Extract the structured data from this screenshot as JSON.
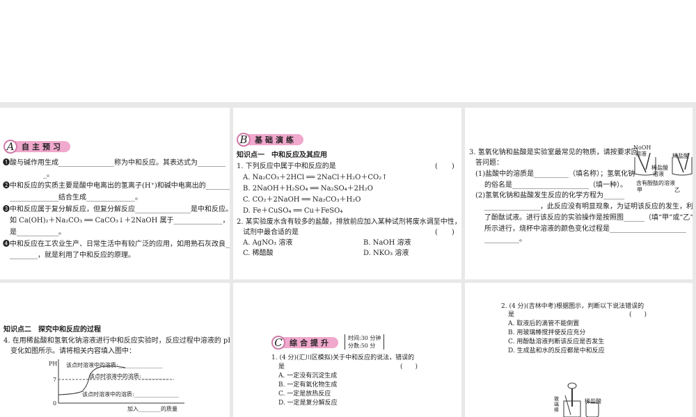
{
  "sectionA": {
    "letter": "A",
    "title": "自主预习",
    "lines": [
      "❶酸与碱作用生成________________称为中和反应。其表达式为________",
      "_。",
      "❷中和反应的实质主要是酸中电离出的氢离子(H⁺)和碱中电离出的________",
      "______________结合生成______________。",
      "❸中和反应属于复分解反应，但复分解反应________________是中和反应。",
      "如 Ca(OH)₂＋Na₂CO₃ ══ CaCO₃↓＋2NaOH 属于______________，但不",
      "是____________。",
      "❹中和反应在工农业生产、日常生活中有较广泛的应用，如用熟石灰改良____",
      "________，就是利用了中和反应的原理。"
    ]
  },
  "sectionB": {
    "letter": "B",
    "title": "基础演练",
    "kp1": "知识点一　中和反应及其应用",
    "lines": [
      "1. 下列反应中属于中和反应的是",
      "A. Na₂CO₃＋2HCl ══ 2NaCl＋H₂O＋CO₂↑",
      "B. 2NaOH＋H₂SO₄ ══ Na₂SO₄＋2H₂O",
      "C. CO₂＋2NaOH ══ Na₂CO₃＋H₂O",
      "D. Fe＋CuSO₄ ══ Cu＋FeSO₄",
      "2. 某实验废水含有较多的盐酸，排放前应加入某种试剂将废水调至中性，下列",
      "试剂中最合适的是"
    ],
    "q2opts": [
      "A. AgNO₃ 溶液",
      "B. NaOH 溶液",
      "C. 稀醋酸",
      "D. NKO₃ 溶液"
    ],
    "paren": "(　　)"
  },
  "q3": {
    "lines": [
      "3. 氢氧化钠和盐酸是实验室最常见的物质，请按要求回",
      "答问题：",
      "(1)盐酸中的溶质是__________（填名称）；氢氧化钠",
      "的俗名是______________________（填一种）。",
      "(2)氢氧化钠和盐酸发生反应的化学方程为______",
      "________________，此反应没有明显现象，为证明该反应的发生，利用",
      "了酚酞试液。进行该反应的实验操作是按照图______（填“甲”或“乙”）",
      "所示进行，烧杯中溶液的颜色变化过程是______________________",
      "__________。"
    ],
    "fig": {
      "naoh": "NoOH",
      "naoh2": "溶液",
      "hcl": "稀盐酸",
      "hcl2": "稀盐酸",
      "hcl3": "溶液",
      "phen": "含有酚酞的溶液",
      "jia": "甲",
      "yi": "乙"
    }
  },
  "kp2": {
    "title": "知识点二　探究中和反应的过程",
    "lines": [
      "4. 在用稀盐酸和氢氧化钠溶液进行中和反应实验时，反应过程中溶液的 pH",
      "变化如图所示。请将相关内容填入图中："
    ],
    "chart": {
      "ylabel": "PH",
      "y7": "7",
      "y0": "0",
      "l1": "该点时溶液中的溶质:________________",
      "l2": "该点时溶液中的溶质:__________",
      "l3": "该点时溶液中的溶质:________________",
      "xlabel": "加入________的质量"
    }
  },
  "sectionC": {
    "letter": "C",
    "title": "综合提升",
    "time": "时间:30 分钟",
    "score": "分数:50 分",
    "q1": [
      "1. (4 分)(汇川区模拟)关于中和反应的说法，错误的",
      "是",
      "A. 一定没有沉淀生成",
      "B. 一定有氧化物生成",
      "C. 一定是放热反应",
      "D. 一定是复分解反应"
    ]
  },
  "q2c": {
    "lines": [
      "2. (4 分)(吉林中考)根据图示，判断以下说法错误的",
      "是",
      "A. 取液后的滴管不能倒置",
      "B. 用玻璃棒搅拌使反应充分",
      "C. 用酚酞溶液判断该反应是否发生",
      "D. 生成盐和水的反应都是中和反应"
    ],
    "rod": "玻璃棒",
    "acid": "稀盐酸"
  }
}
